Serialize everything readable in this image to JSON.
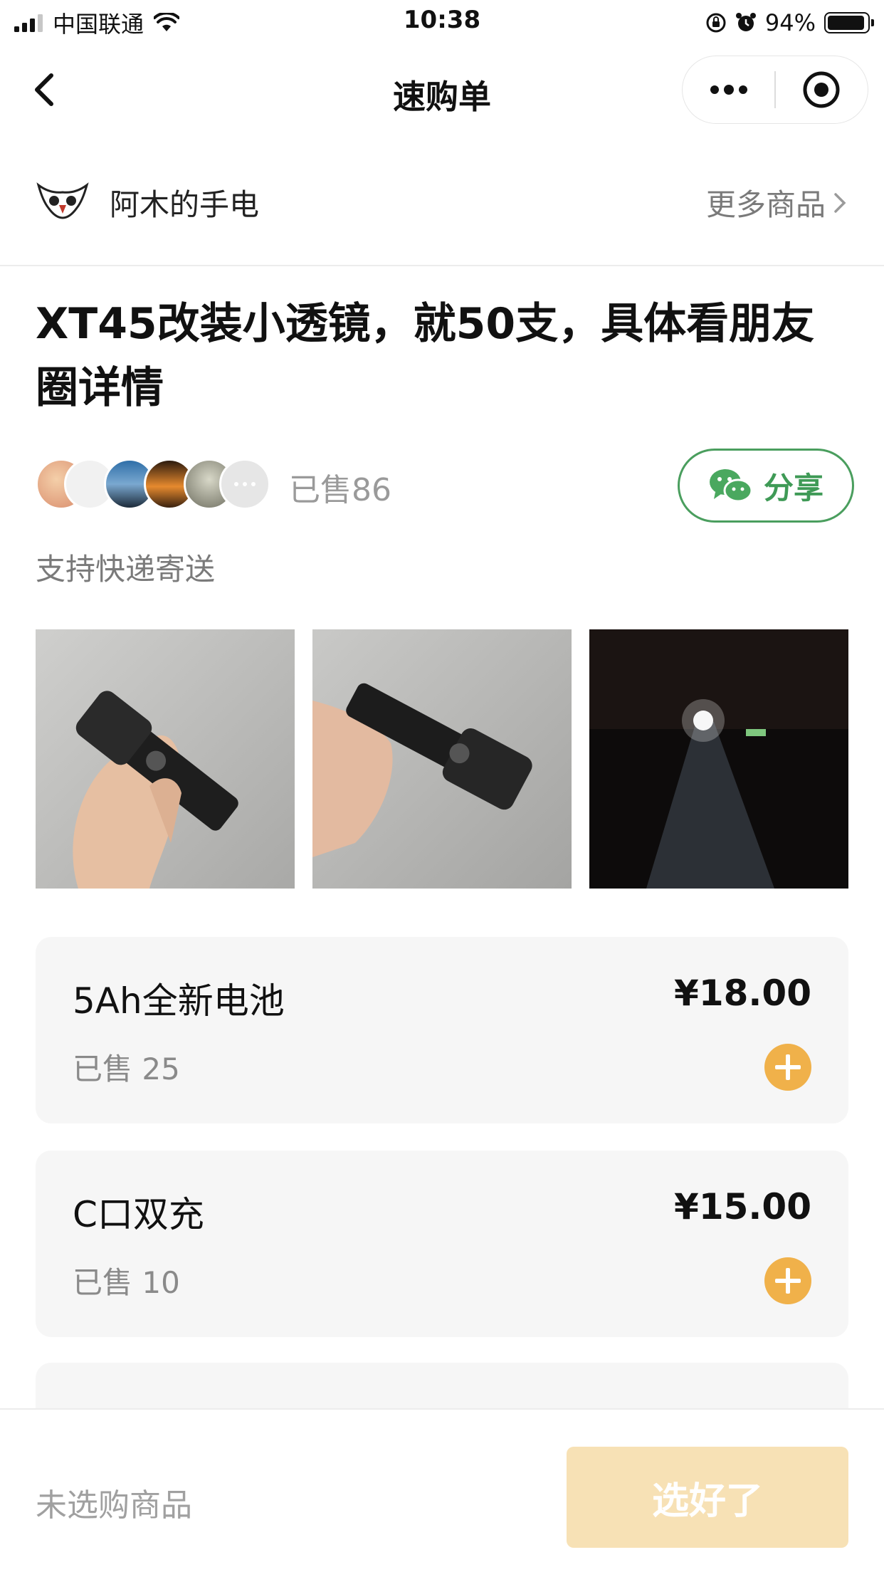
{
  "status_bar": {
    "carrier": "中国联通",
    "time": "10:38",
    "battery_percent": "94%",
    "battery_level": 0.94
  },
  "nav": {
    "title": "速购单"
  },
  "store": {
    "name": "阿木的手电",
    "more_goods": "更多商品"
  },
  "listing": {
    "title": "XT45改装小透镜，就50支，具体看朋友圈详情",
    "sold_total": "已售86",
    "share_label": "分享",
    "delivery": "支持快递寄送"
  },
  "products": [
    {
      "name": "5Ah全新电池",
      "price": "¥18.00",
      "sold": "已售 25"
    },
    {
      "name": "C口双充",
      "price": "¥15.00",
      "sold": "已售 10"
    }
  ],
  "bottom": {
    "no_selection": "未选购商品",
    "done_label": "选好了"
  },
  "colors": {
    "accent_orange": "#f0b14a",
    "share_green": "#4a9e5e",
    "done_button_bg": "#f7e1b5",
    "card_bg": "#f6f6f6"
  }
}
